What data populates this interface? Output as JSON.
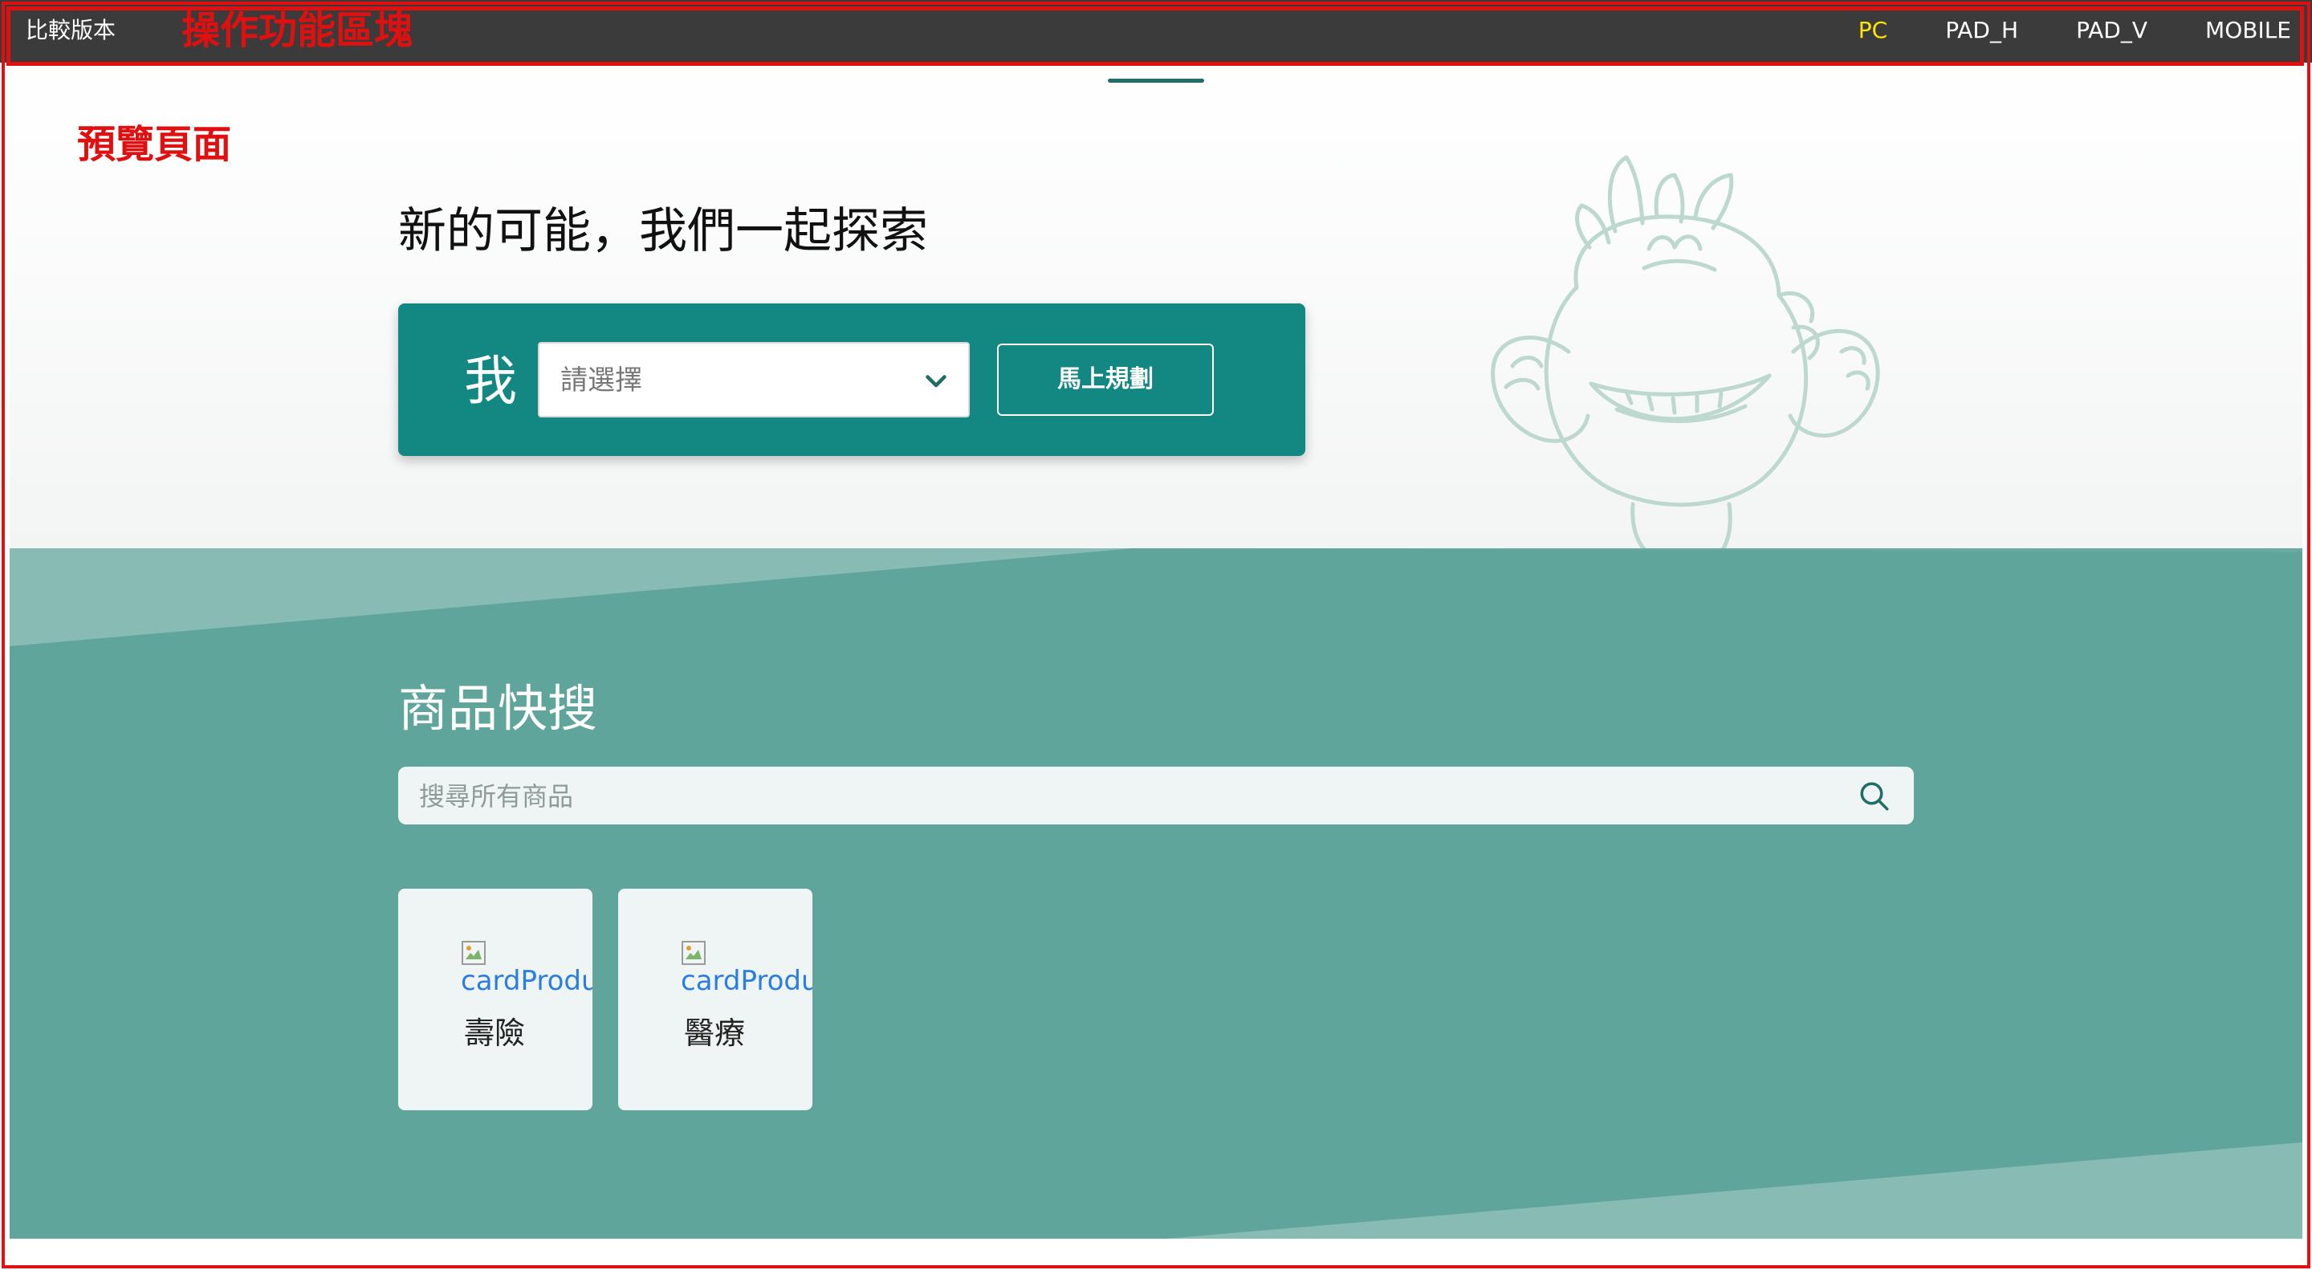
{
  "toolbar": {
    "compare_label": "比較版本",
    "annotation": "操作功能區塊",
    "tabs": [
      {
        "label": "PC",
        "active": true
      },
      {
        "label": "PAD_H",
        "active": false
      },
      {
        "label": "PAD_V",
        "active": false
      },
      {
        "label": "MOBILE",
        "active": false
      }
    ],
    "active_color": "#ffe600",
    "background": "#3b3b3b"
  },
  "preview": {
    "annotation": "預覽頁面",
    "annotation_color": "#e01010"
  },
  "hero": {
    "title": "新的可能，我們一起探索",
    "plan": {
      "me_label": "我",
      "select_placeholder": "請選擇",
      "button_label": "馬上規劃",
      "card_color": "#138882"
    },
    "mascot_icon": "dragon-mascot-illustration"
  },
  "search_section": {
    "title": "商品快搜",
    "search_placeholder": "搜尋所有商品",
    "search_icon": "search-icon",
    "background": "#5fa59c",
    "cards": [
      {
        "img_alt": "cardProduct",
        "label": "壽險"
      },
      {
        "img_alt": "cardProduct",
        "label": "醫療"
      }
    ]
  }
}
